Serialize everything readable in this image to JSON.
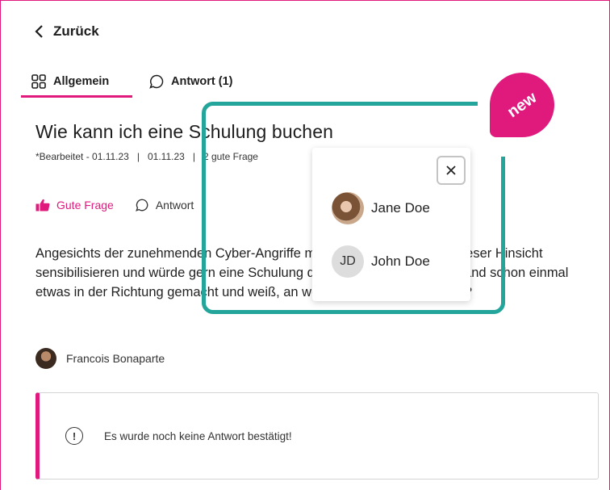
{
  "nav": {
    "back_label": "Zurück"
  },
  "tabs": [
    {
      "label": "Allgemein",
      "icon": "grid-icon",
      "active": true
    },
    {
      "label": "Antwort (1)",
      "icon": "speech-bubble-icon",
      "active": false
    }
  ],
  "question": {
    "title": "Wie kann ich eine Schulung buchen",
    "meta": [
      "*Bearbeitet - 01.11.23",
      "01.11.23",
      "2 gute Frage"
    ],
    "actions": {
      "like_label": "Gute Frage",
      "reply_label": "Antwort"
    },
    "body": "Angesichts der zunehmenden Cyber-Angriffe möchte ich mein Team in dieser Hinsicht sensibilisieren und würde gern eine Schulung dazu durchführen. Hat jemand schon einmal etwas in der Richtung gemacht und weiß, an wen ich mich wenden muss?",
    "author": "Francois Bonaparte"
  },
  "notice": {
    "text": "Es wurde noch keine Antwort bestätigt!",
    "icon": "exclamation-circle-icon"
  },
  "popup": {
    "close_icon": "close-icon",
    "users": [
      {
        "name": "Jane Doe",
        "avatar": "photo"
      },
      {
        "name": "John Doe",
        "initials": "JD"
      }
    ]
  },
  "badge": {
    "text": "new"
  },
  "colors": {
    "accent": "#e0197d",
    "highlight": "#23a59b"
  }
}
